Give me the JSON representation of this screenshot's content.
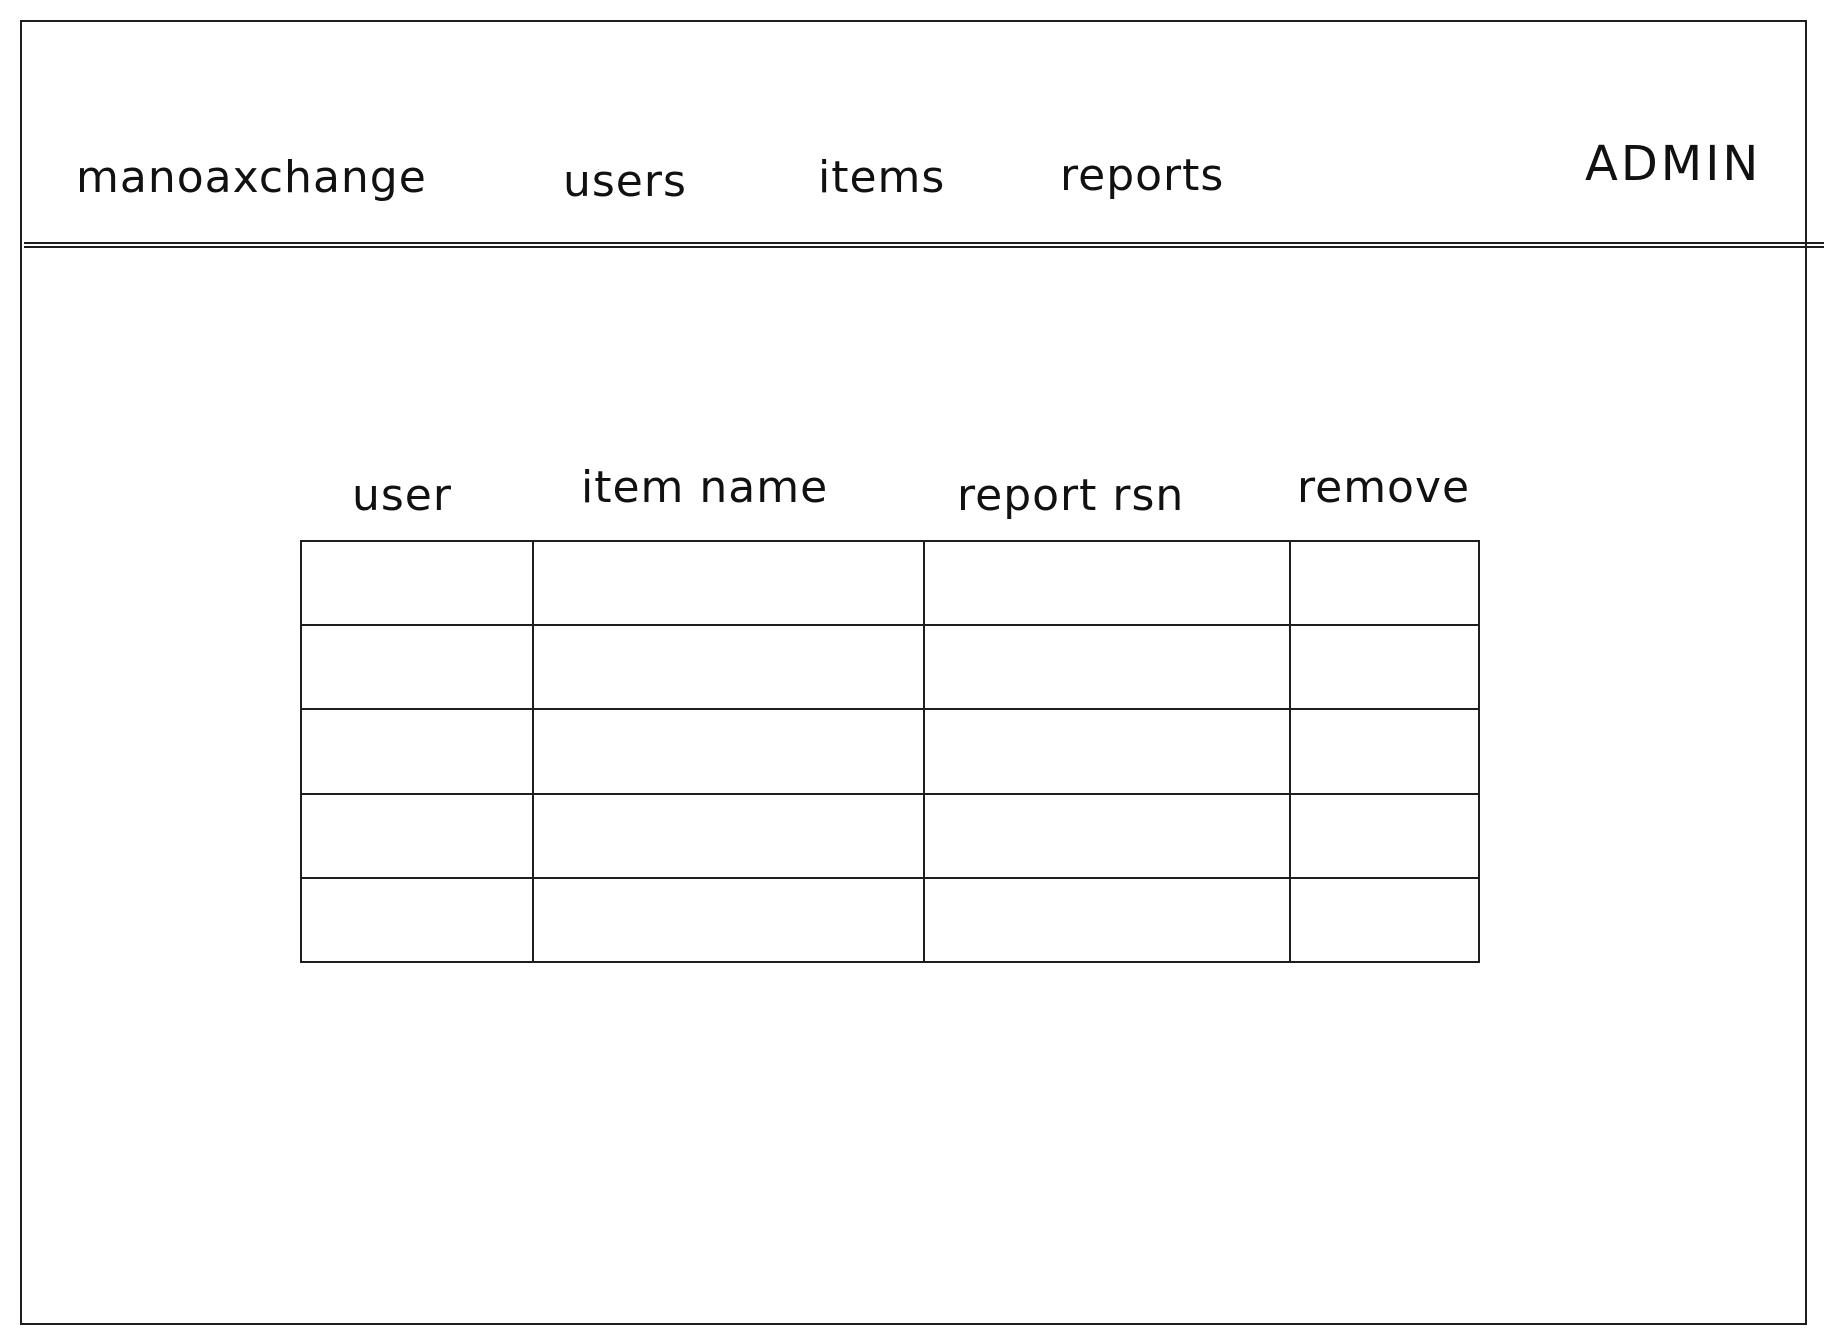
{
  "header": {
    "brand": "manoaxchange",
    "nav": [
      "users",
      "items",
      "reports"
    ],
    "role": "ADMIN"
  },
  "table": {
    "columns": [
      "user",
      "item name",
      "report rsn",
      "remove"
    ],
    "row_count": 5
  }
}
